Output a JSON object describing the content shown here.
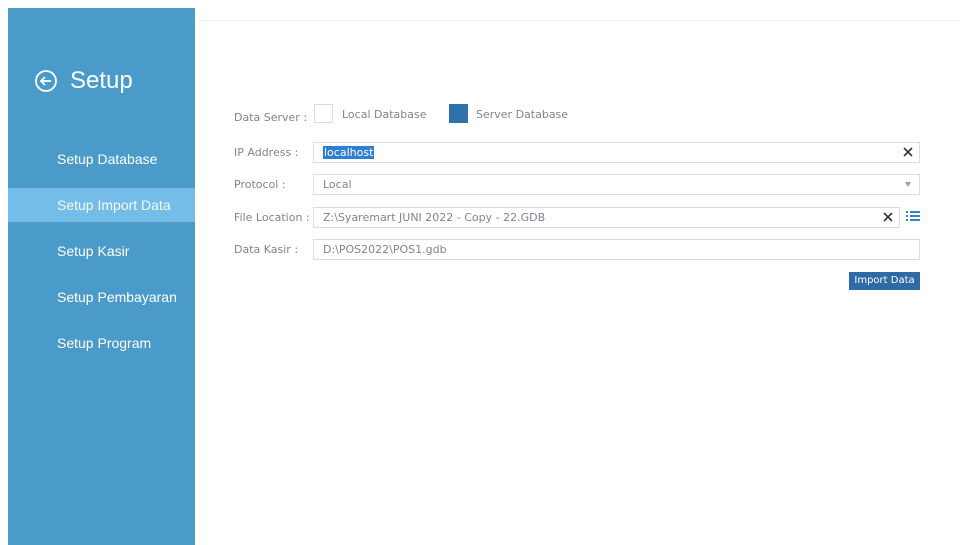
{
  "sidebar": {
    "title": "Setup",
    "items": [
      {
        "label": "Setup Database",
        "active": false
      },
      {
        "label": "Setup Import Data",
        "active": true
      },
      {
        "label": "Setup Kasir",
        "active": false
      },
      {
        "label": "Setup Pembayaran",
        "active": false
      },
      {
        "label": "Setup Program",
        "active": false
      }
    ]
  },
  "form": {
    "data_server": {
      "label": "Data Server :",
      "options": [
        {
          "label": "Local Database",
          "checked": false
        },
        {
          "label": "Server Database",
          "checked": true
        }
      ]
    },
    "ip_address": {
      "label": "IP Address :",
      "value": "localhost"
    },
    "protocol": {
      "label": "Protocol :",
      "value": "Local"
    },
    "file_location": {
      "label": "File Location :",
      "value": "Z:\\Syaremart JUNI 2022 - Copy - 22.GDB"
    },
    "data_kasir": {
      "label": "Data Kasir :",
      "value": "D:\\POS2022\\POS1.gdb"
    },
    "import_button": "Import Data"
  },
  "colors": {
    "sidebar_bg": "#4a9bc9",
    "active_item": "#74bde8",
    "checked": "#2f72aa",
    "button": "#2d6aa6"
  }
}
